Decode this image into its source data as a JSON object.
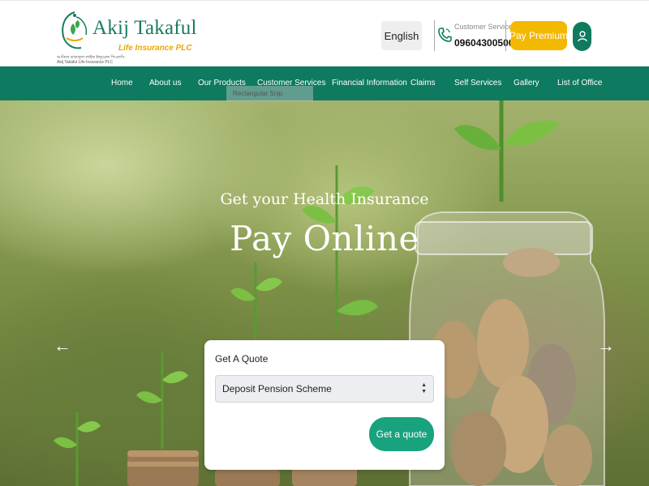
{
  "header": {
    "logo_title": "Akij Takaful",
    "logo_subtitle": "Life Insurance PLC",
    "logo_tiny_bn": "আকিজ তাকাফুল লাইফ ইন্স্যুরেন্স পিএলসি",
    "logo_tiny_en": "Akij Takaful Life Insurance PLC",
    "language_label": "English",
    "customer_service_label": "Customer Service",
    "customer_service_number": "09604300500",
    "pay_premium_label": "Pay Premium"
  },
  "nav": {
    "items": [
      "Home",
      "About us",
      "Our Products",
      "Customer Services",
      "Financial Information",
      "Claims",
      "Self Services",
      "Gallery",
      "List of Office"
    ]
  },
  "overlay": {
    "snip_label": "Rectangular Snip"
  },
  "hero": {
    "subtitle": "Get your Health Insurance",
    "title": "Pay Online",
    "prev_arrow": "←",
    "next_arrow": "→"
  },
  "quote": {
    "label": "Get A Quote",
    "selected_option": "Deposit Pension Scheme",
    "button_label": "Get a quote"
  },
  "colors": {
    "brand_green": "#0e7a60",
    "accent_yellow": "#f3b800",
    "button_green": "#18a27e"
  }
}
